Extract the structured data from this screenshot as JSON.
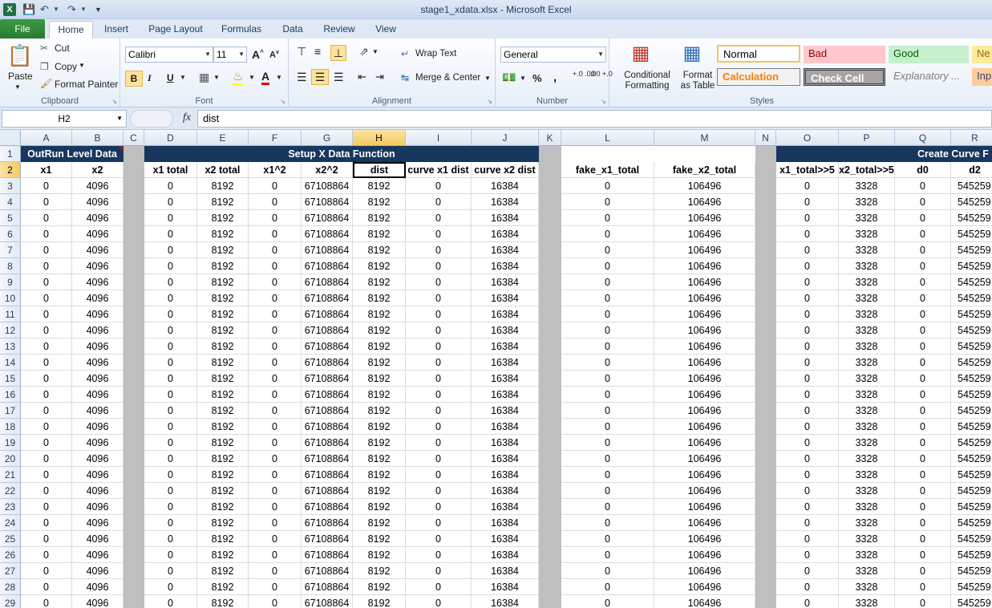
{
  "window": {
    "title": "stage1_xdata.xlsx  -  Microsoft Excel",
    "app_icon": "X"
  },
  "tabs": [
    "File",
    "Home",
    "Insert",
    "Page Layout",
    "Formulas",
    "Data",
    "Review",
    "View"
  ],
  "active_tab": "Home",
  "clipboard": {
    "paste": "Paste",
    "cut": "Cut",
    "copy": "Copy",
    "format_painter": "Format Painter",
    "label": "Clipboard"
  },
  "font": {
    "name": "Calibri",
    "size": "11",
    "bold": "B",
    "italic": "I",
    "underline": "U",
    "font_color_glyph": "A",
    "label": "Font"
  },
  "alignment": {
    "wrap_text": "Wrap Text",
    "merge_center": "Merge & Center",
    "label": "Alignment"
  },
  "number": {
    "format": "General",
    "percent": "%",
    "comma": ",",
    "inc_dec": "+.0 .00",
    "dec_dec": ".00 +.0",
    "label": "Number"
  },
  "styles_group": {
    "conditional": "Conditional Formatting",
    "format_table": "Format as Table",
    "label": "Styles",
    "cells": {
      "normal": "Normal",
      "bad": "Bad",
      "good": "Good",
      "neutral": "Ne",
      "calculation": "Calculation",
      "check_cell": "Check Cell",
      "explanatory": "Explanatory ...",
      "input": "Inp"
    }
  },
  "formula_bar": {
    "name_box": "H2",
    "fx": "fx",
    "value": "dist"
  },
  "columns": [
    "A",
    "B",
    "C",
    "D",
    "E",
    "F",
    "G",
    "H",
    "I",
    "J",
    "K",
    "L",
    "M",
    "N",
    "O",
    "P",
    "Q",
    "R"
  ],
  "selected_column": "H",
  "bands": {
    "outrun": "OutRun Level Data",
    "setup": "Setup X Data Function",
    "curve": "Create Curve F"
  },
  "headers": {
    "A": "x1",
    "B": "x2",
    "D": "x1 total",
    "E": "x2 total",
    "F": "x1^2",
    "G": "x2^2",
    "H": "dist",
    "I": "curve x1 dist",
    "J": "curve x2 dist",
    "L": "fake_x1_total",
    "M": "fake_x2_total",
    "O": "x1_total>>5",
    "P": "x2_total>>5",
    "Q": "d0",
    "R": "d2"
  },
  "row_values": {
    "A": "0",
    "B": "4096",
    "D": "0",
    "E": "8192",
    "F": "0",
    "G": "67108864",
    "H": "8192",
    "I": "0",
    "J": "16384",
    "L": "0",
    "M": "106496",
    "O": "0",
    "P": "3328",
    "Q": "0",
    "R": "545259"
  },
  "row_numbers": [
    "1",
    "2",
    "3",
    "4",
    "5",
    "6",
    "7",
    "8",
    "9",
    "10",
    "11",
    "12",
    "13",
    "14",
    "15",
    "16",
    "17",
    "18",
    "19",
    "20",
    "21",
    "22",
    "23",
    "24",
    "25",
    "26",
    "27",
    "28",
    "29"
  ],
  "colors": {
    "band": "#17375e",
    "gray_col": "#bfbfbf",
    "selection": "#f5c95d",
    "file_tab": "#2a7a33"
  }
}
